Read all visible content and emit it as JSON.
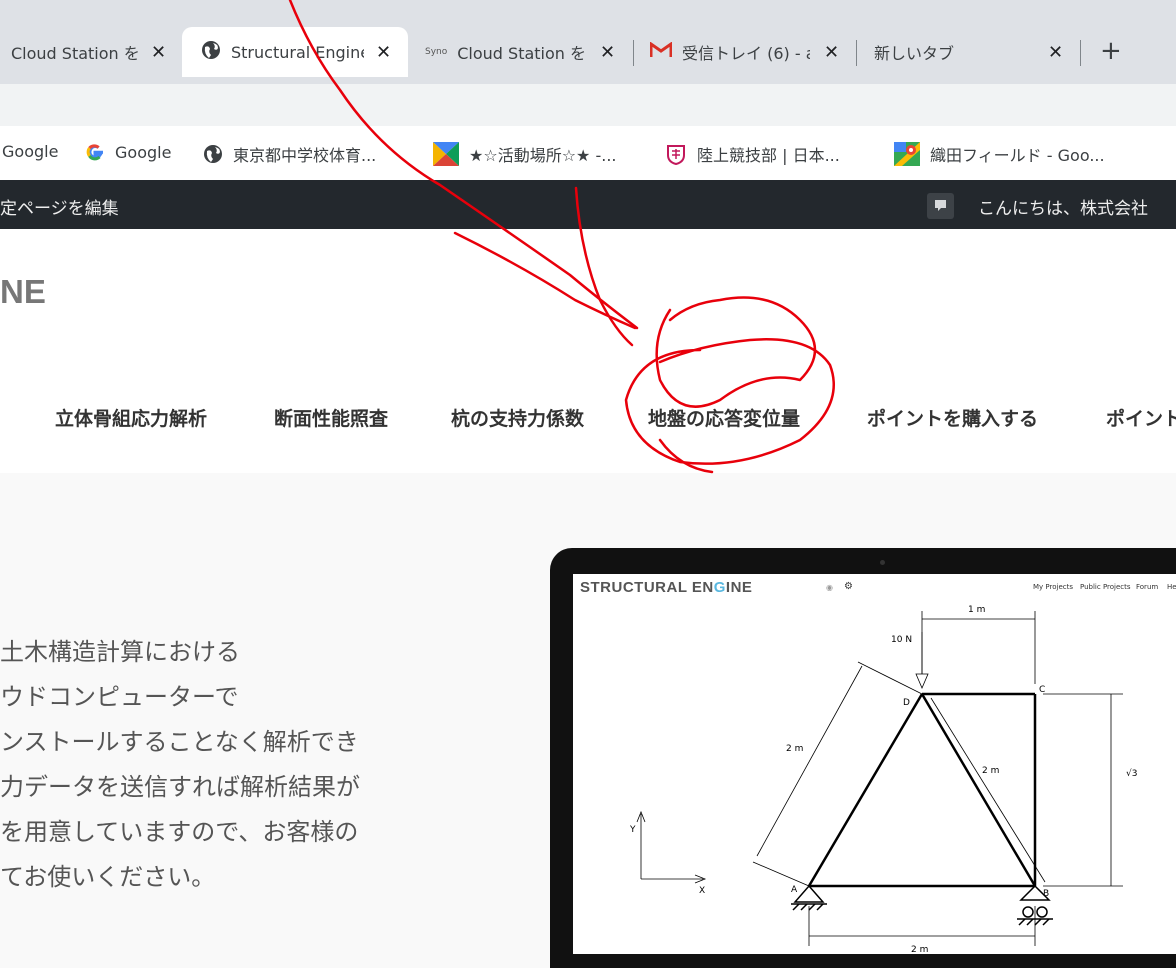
{
  "tabs": [
    {
      "title": "Cloud Station を",
      "icon": "none",
      "active": false
    },
    {
      "title": "Structural Engine",
      "icon": "globe-icon",
      "active": true
    },
    {
      "title": "Cloud Station を",
      "icon": "synology-icon",
      "icon_text": "Syno",
      "active": false
    },
    {
      "title": "受信トレイ (6) - a",
      "icon": "gmail-icon",
      "active": false
    },
    {
      "title": "新しいタブ",
      "icon": "none",
      "active": false
    }
  ],
  "tab_close_glyph": "✕",
  "new_tab_glyph": "+",
  "bookmarks": [
    {
      "label": "Google",
      "icon": "none"
    },
    {
      "label": "Google",
      "icon": "google-icon"
    },
    {
      "label": "東京都中学校体育...",
      "icon": "globe-icon"
    },
    {
      "label": "★☆活動場所☆★ -...",
      "icon": "colorful-m-icon"
    },
    {
      "label": "陸上競技部 | 日本...",
      "icon": "school-crest-icon"
    },
    {
      "label": "織田フィールド - Goo...",
      "icon": "google-maps-icon"
    }
  ],
  "admin_bar": {
    "edit_label": "定ページを編集",
    "greeting": "こんにちは、株式会社"
  },
  "site": {
    "logo_fragment": "NE",
    "nav": [
      "、",
      "立体骨組応力解析",
      "断面性能照査",
      "杭の支持力係数",
      "地盤の応答変位量",
      "ポイントを購入する",
      "ポイント"
    ]
  },
  "hero": {
    "lines": [
      "土木構造計算における",
      "ウドコンピューターで",
      "ンストールすることなく解析でき",
      "力データを送信すれば解析結果が",
      "を用意していますので、お客様の",
      "てお使いください。"
    ]
  },
  "screenshot": {
    "logo_pre": "STRUCTURAL EN",
    "logo_g": "G",
    "logo_post": "INE",
    "nav": [
      "My Projects",
      "Public Projects",
      "Forum",
      "He"
    ],
    "labels": {
      "force": "10 N",
      "top_dim": "1 m",
      "left_dim": "2 m",
      "diag_dim": "2 m",
      "right_dim": "√3",
      "bottom_dim": "2 m",
      "node_a": "A",
      "node_b": "B",
      "node_c": "C",
      "node_d": "D",
      "axis_x": "X",
      "axis_y": "Y"
    }
  },
  "colors": {
    "tabstrip": "#dee1e6",
    "admin_bar": "#23282d",
    "annotation": "#e8000b",
    "gmail": "#d93025"
  }
}
